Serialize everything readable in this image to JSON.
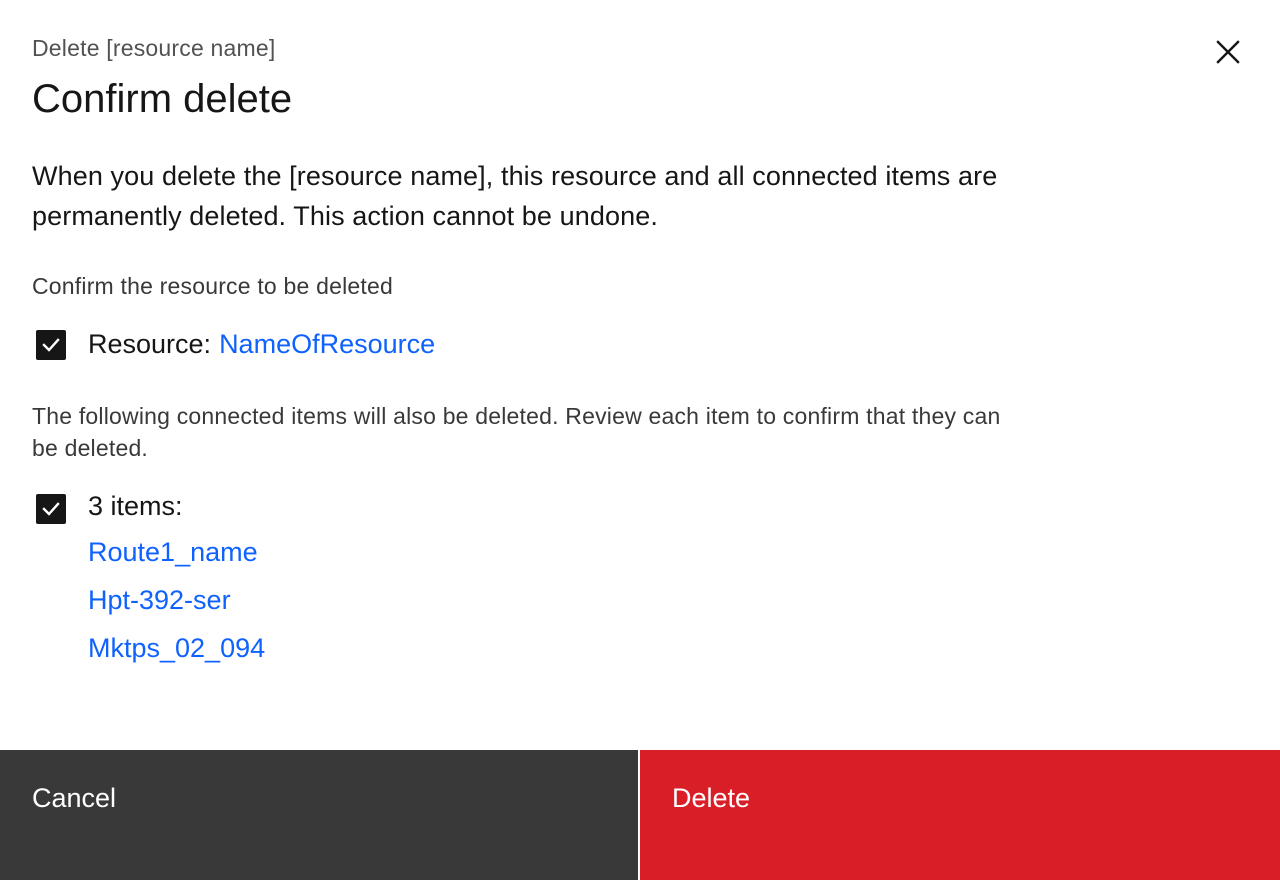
{
  "modal": {
    "eyebrow": "Delete [resource name]",
    "title": "Confirm delete",
    "description": "When you delete the [resource name], this resource and all connected items are permanently deleted. This action cannot be undone.",
    "confirm_label": "Confirm the resource to be deleted",
    "resource": {
      "label": "Resource:",
      "name": "NameOfResource",
      "checked": true
    },
    "connected_info": "The following connected items will also be deleted. Review each item to confirm that they can be deleted.",
    "items": {
      "label": "3 items:",
      "checked": true,
      "list": [
        "Route1_name",
        "Hpt-392-ser",
        "Mktps_02_094"
      ]
    },
    "close_icon": "close-icon",
    "check_icon": "checkmark-icon"
  },
  "footer": {
    "cancel_label": "Cancel",
    "delete_label": "Delete"
  },
  "colors": {
    "link": "#0f62fe",
    "danger": "#da1e28",
    "secondary": "#393939",
    "text": "#161616"
  }
}
